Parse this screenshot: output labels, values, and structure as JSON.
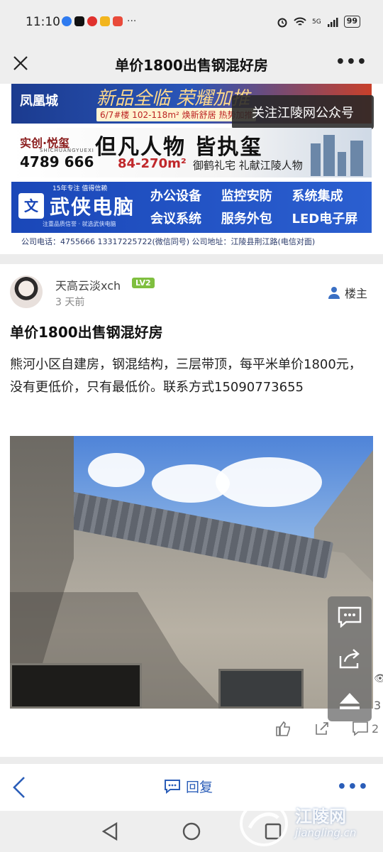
{
  "status_bar": {
    "time": "11:10",
    "more_dots": "···",
    "network": "5G",
    "battery": "99"
  },
  "title_bar": {
    "title": "单价1800出售钢混好房",
    "more": "•••"
  },
  "ads": {
    "follow_badge": "关注江陵网公众号",
    "banner1": {
      "logo": "凤凰城",
      "headline": "新品全临 荣耀加推",
      "sub": "6/7#楼 102-118m² 焕新舒居 热势加推"
    },
    "banner2": {
      "brand": "实创·悦玺",
      "brand_en": "SHICHUANGYUEXI",
      "phone": "4789 666",
      "slogan": "但凡人物 皆执玺",
      "area": "84-270m²",
      "tagline": "御鹤礼宅 礼献江陵人物"
    },
    "banner3": {
      "top_tag": "15年专注 值得信赖",
      "name": "武侠电脑",
      "small": "注重品质信誉 · 就选武侠电脑",
      "services": [
        "办公设备",
        "监控安防",
        "系统集成",
        "会议系统",
        "服务外包",
        "LED电子屏"
      ],
      "contact": "公司电话：4755666  13317225722(微信同号)  公司地址：江陵县荆江路(电信对面)"
    }
  },
  "post": {
    "username": "天高云淡xch",
    "level": "LV2",
    "time": "3 天前",
    "op_label": "楼主",
    "title": "单价1800出售钢混好房",
    "body": "熊河小区自建房，钢混结构，三层带顶，每平米单价1800元，没有更低价，只有最低价。联系方式15090773655",
    "side_counts": {
      "views_edge": "3",
      "comments": "2"
    }
  },
  "bottom_bar": {
    "reply": "回复",
    "more": "•••"
  },
  "watermark": {
    "name": "江陵网",
    "url": "jiangling.cn"
  },
  "colors": {
    "accent": "#2a5db8",
    "level_badge": "#7fbf3f",
    "background": "#ececec"
  }
}
